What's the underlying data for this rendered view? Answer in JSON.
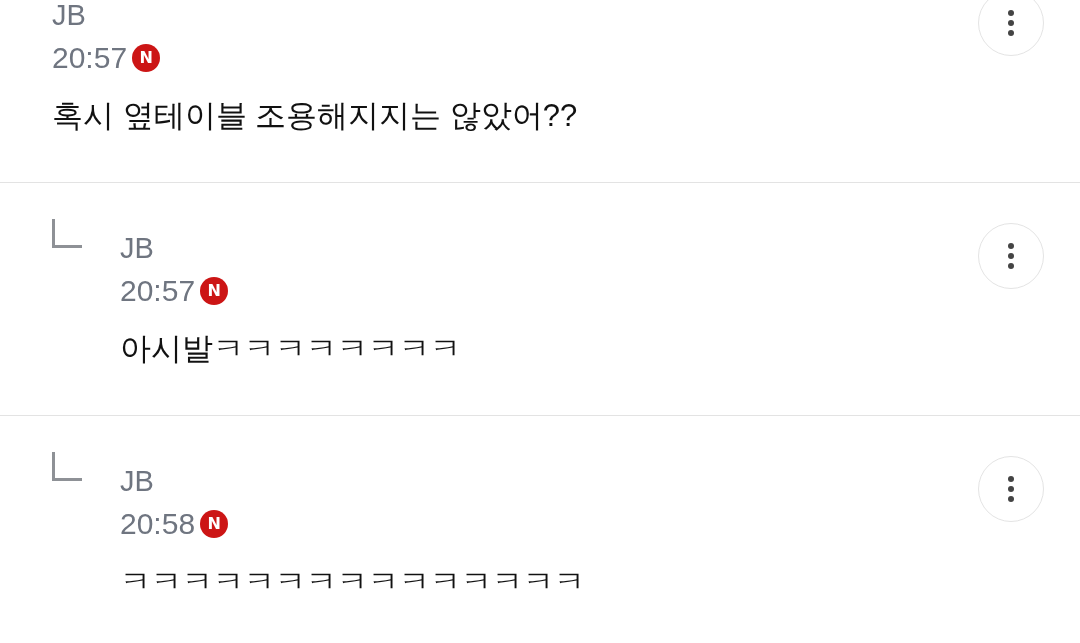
{
  "comments": [
    {
      "kind": "comment",
      "author": "JB",
      "time": "20:57",
      "badge": "N",
      "text": "혹시 옆테이블 조용해지지는 않았어??"
    },
    {
      "kind": "reply",
      "author": "JB",
      "time": "20:57",
      "badge": "N",
      "text": "아시발ㅋㅋㅋㅋㅋㅋㅋㅋ"
    },
    {
      "kind": "reply",
      "author": "JB",
      "time": "20:58",
      "badge": "N",
      "text": "ㅋㅋㅋㅋㅋㅋㅋㅋㅋㅋㅋㅋㅋㅋㅋ"
    }
  ]
}
